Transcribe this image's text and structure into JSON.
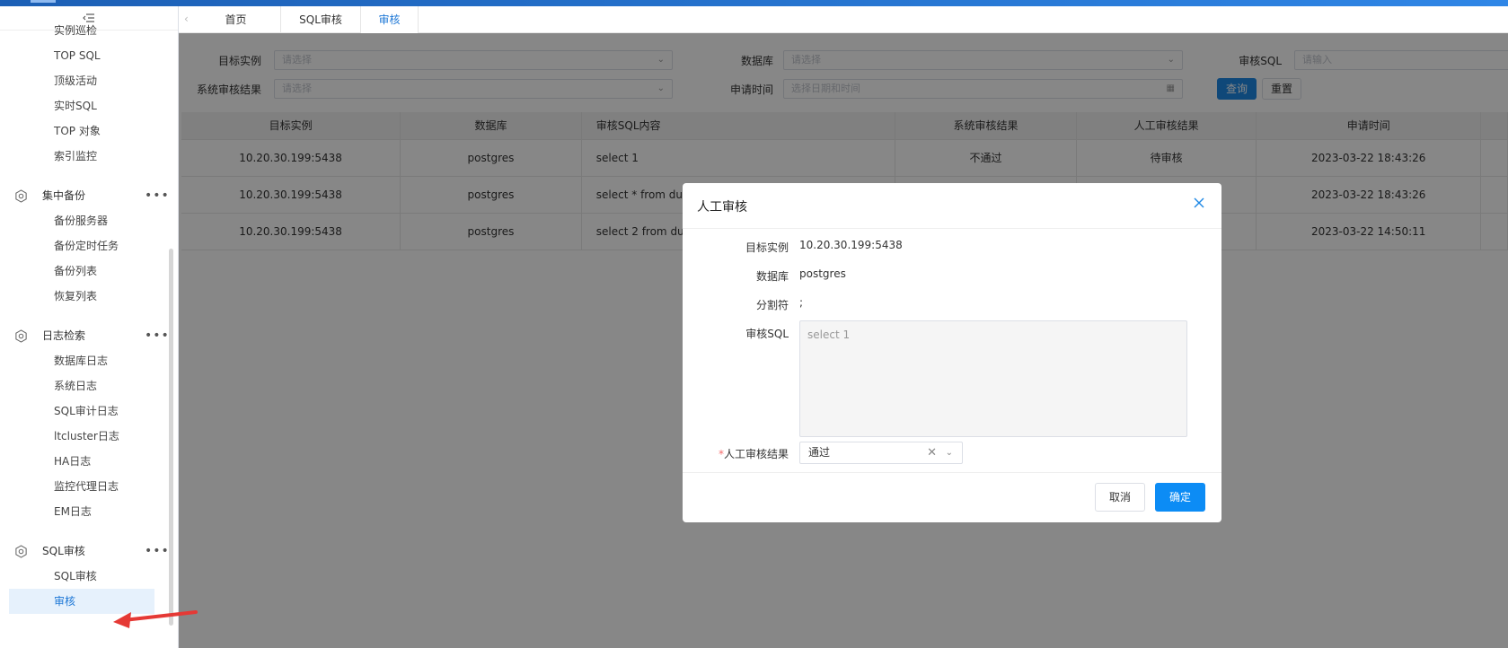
{
  "sidebar": {
    "pre_items": [
      "实例巡检",
      "TOP SQL",
      "顶级活动",
      "实时SQL",
      "TOP 对象",
      "索引监控"
    ],
    "groups": [
      {
        "title": "集中备份",
        "icon": "gear-icon",
        "items": [
          "备份服务器",
          "备份定时任务",
          "备份列表",
          "恢复列表"
        ]
      },
      {
        "title": "日志检索",
        "icon": "gear-icon",
        "items": [
          "数据库日志",
          "系统日志",
          "SQL审计日志",
          "ltcluster日志",
          "HA日志",
          "监控代理日志",
          "EM日志"
        ]
      },
      {
        "title": "SQL审核",
        "icon": "gear-icon",
        "items": [
          "SQL审核",
          "审核"
        ]
      }
    ],
    "more_glyph": "•••"
  },
  "tabs": [
    {
      "label": "首页"
    },
    {
      "label": "SQL审核"
    },
    {
      "label": "审核"
    }
  ],
  "filters": {
    "target_label": "目标实例",
    "target_placeholder": "请选择",
    "db_label": "数据库",
    "db_placeholder": "请选择",
    "sql_label": "审核SQL",
    "sql_placeholder": "请输入",
    "sysresult_label": "系统审核结果",
    "sysresult_placeholder": "请选择",
    "time_label": "申请时间",
    "time_placeholder": "选择日期和时间",
    "query_button": "查询",
    "reset_button": "重置"
  },
  "table": {
    "columns": [
      "目标实例",
      "数据库",
      "审核SQL内容",
      "系统审核结果",
      "人工审核结果",
      "申请时间"
    ],
    "rows": [
      [
        "10.20.30.199:5438",
        "postgres",
        "select 1",
        "不通过",
        "待审核",
        "2023-03-22 18:43:26"
      ],
      [
        "10.20.30.199:5438",
        "postgres",
        "select * from dual",
        "",
        "",
        "2023-03-22 18:43:26"
      ],
      [
        "10.20.30.199:5438",
        "postgres",
        "select 2 from dual",
        "",
        "",
        "2023-03-22 14:50:11"
      ]
    ]
  },
  "modal": {
    "title": "人工审核",
    "target_label": "目标实例",
    "target_value": "10.20.30.199:5438",
    "db_label": "数据库",
    "db_value": "postgres",
    "sep_label": "分割符",
    "sep_value": ";",
    "sql_label": "审核SQL",
    "sql_value": "select 1",
    "result_required": "*",
    "result_label": "人工审核结果",
    "result_value": "通过",
    "cancel_button": "取消",
    "ok_button": "确定"
  },
  "colors": {
    "primary": "#0c8cf5",
    "topbar": "#2f86e6",
    "active_bg": "#e6f1fc",
    "arrow": "#e53935"
  }
}
